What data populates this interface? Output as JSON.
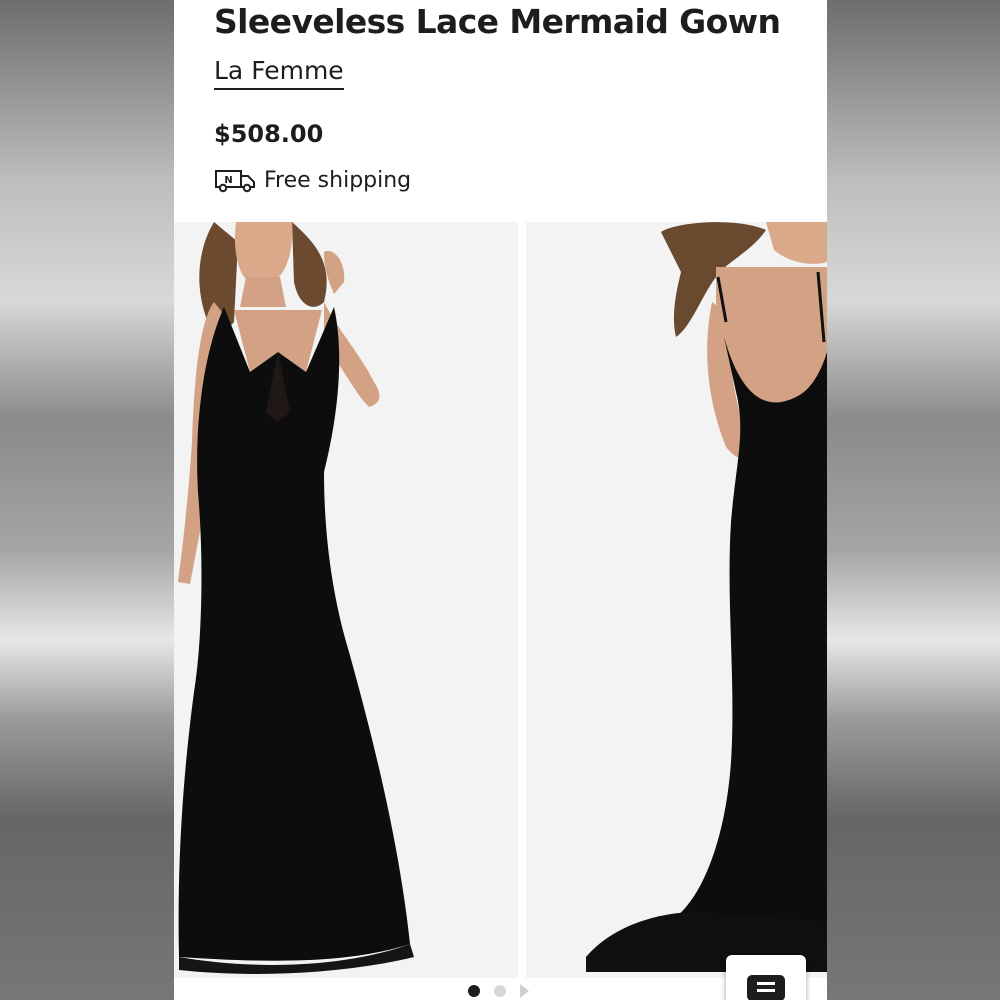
{
  "product": {
    "title": "Sleeveless Lace Mermaid Gown",
    "brand": "La Femme",
    "price": "$508.00",
    "shipping_label": "Free shipping",
    "shipping_icon_letter": "N"
  },
  "gallery": {
    "images": [
      {
        "icon": "gown-front-photo"
      },
      {
        "icon": "gown-back-photo"
      }
    ],
    "current_index": 1,
    "total_dots": 2
  },
  "colors": {
    "background_side": "#9a9a9a",
    "text": "#1d1d1d",
    "dress": "#0c0c0c",
    "photo_bg": "#f2f2f2"
  }
}
